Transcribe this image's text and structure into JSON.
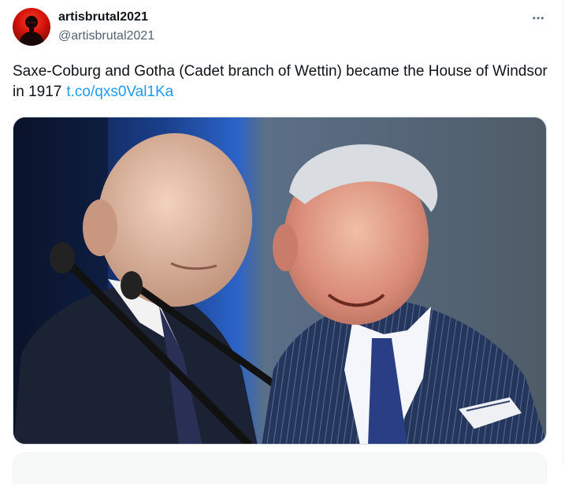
{
  "author": {
    "display_name": "artisbrutal2021",
    "handle": "@artisbrutal2021",
    "avatar_icon": "red-avatar-silhouette"
  },
  "tweet": {
    "text": "Saxe-Coburg and Gotha (Cadet branch of Wettin) became the House of Windsor in 1917",
    "link_text": "t.co/qxs0Val1Ka"
  },
  "icons": {
    "more": "more-horizontal-icon"
  },
  "colors": {
    "link": "#1d9bf0",
    "text": "#0f1419",
    "secondary_text": "#536471",
    "border": "#cfd9de"
  }
}
